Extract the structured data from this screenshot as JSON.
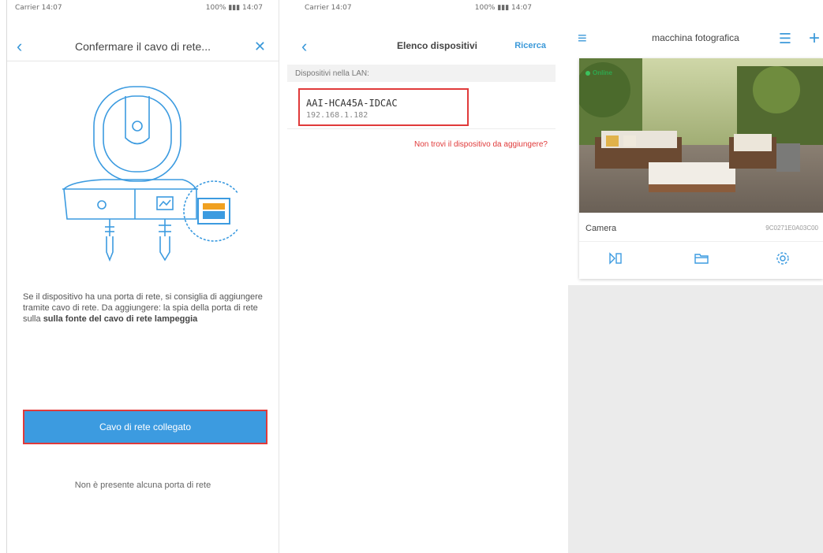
{
  "screen1": {
    "status_left": "Carrier 14:07",
    "status_right": "100% ▮▮▮ 14:07",
    "title": "Confermare il cavo di rete...",
    "back_icon": "chevron-left-icon",
    "close_icon": "close-icon",
    "description_plain": "Se il dispositivo ha una porta di rete, si consiglia di aggiungere tramite cavo di rete. Da aggiungere: la spia della porta di rete sulla ",
    "description_bold": "sulla fonte del cavo di rete lampeggia",
    "primary_button": "Cavo di rete collegato",
    "link_text": "Non è presente alcuna porta di rete"
  },
  "screen2": {
    "status_left": "Carrier 14:07",
    "status_right": "100% ▮▮▮ 14:07",
    "title": "Elenco dispositivi",
    "search_label": "Ricerca",
    "section_label": "Dispositivi nella LAN:",
    "devices": [
      {
        "id": "AAI-HCA45A-IDCAC",
        "ip": "192.168.1.182"
      }
    ],
    "warning_link": "Non trovi il dispositivo da aggiungere?"
  },
  "screen3": {
    "title": "macchina fotografica",
    "menu_icon": "hamburger-menu-icon",
    "grid_icon": "list-view-icon",
    "add_icon": "plus-icon",
    "online_label": "Online",
    "camera_name": "Camera",
    "camera_serial": "9C0271E0A03C00",
    "actions": [
      "playback-icon",
      "folder-icon",
      "settings-gear-icon"
    ]
  },
  "colors": {
    "accent": "#3c9be0",
    "highlight": "#e03a3a",
    "online": "#3cc25e"
  }
}
